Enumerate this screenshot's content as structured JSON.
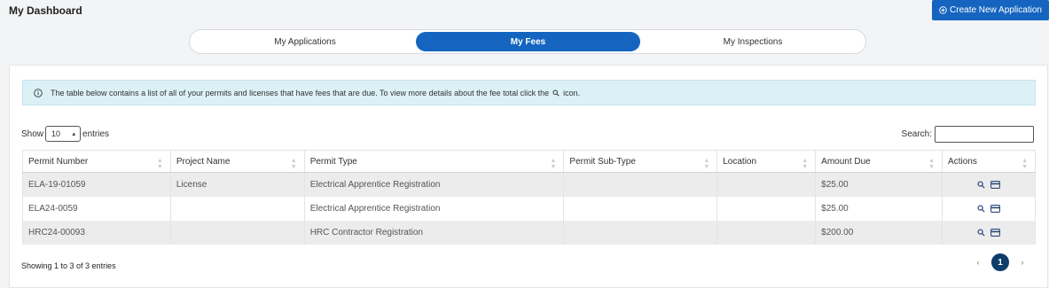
{
  "header": {
    "title": "My Dashboard",
    "create_button_label": "Create New Application"
  },
  "tabs": [
    {
      "label": "My Applications",
      "active": false
    },
    {
      "label": "My Fees",
      "active": true
    },
    {
      "label": "My Inspections",
      "active": false
    }
  ],
  "info_message": {
    "text_before": "The table below contains a list of all of your permits and licenses that have fees that are due. To view more details about the fee total click the",
    "text_after": "icon."
  },
  "table_controls": {
    "show_label": "Show",
    "entries_label": "entries",
    "page_length": "10",
    "search_label": "Search:"
  },
  "table": {
    "columns": [
      "Permit Number",
      "Project Name",
      "Permit Type",
      "Permit Sub-Type",
      "Location",
      "Amount Due",
      "Actions"
    ],
    "rows": [
      {
        "permit_number": "ELA-19-01059",
        "project_name": "License",
        "permit_type": "Electrical Apprentice Registration",
        "permit_sub_type": "",
        "location": "",
        "amount_due": "$25.00"
      },
      {
        "permit_number": "ELA24-0059",
        "project_name": "",
        "permit_type": "Electrical Apprentice Registration",
        "permit_sub_type": "",
        "location": "",
        "amount_due": "$25.00"
      },
      {
        "permit_number": "HRC24-00093",
        "project_name": "",
        "permit_type": "HRC Contractor Registration",
        "permit_sub_type": "",
        "location": "",
        "amount_due": "$200.00"
      }
    ]
  },
  "footer": {
    "info": "Showing 1 to 3 of 3 entries",
    "prev": "‹",
    "current_page": "1",
    "next": "›"
  },
  "colors": {
    "primary": "#1565c0",
    "page_active": "#0d3d68",
    "info_bg": "#dcf1f6"
  }
}
